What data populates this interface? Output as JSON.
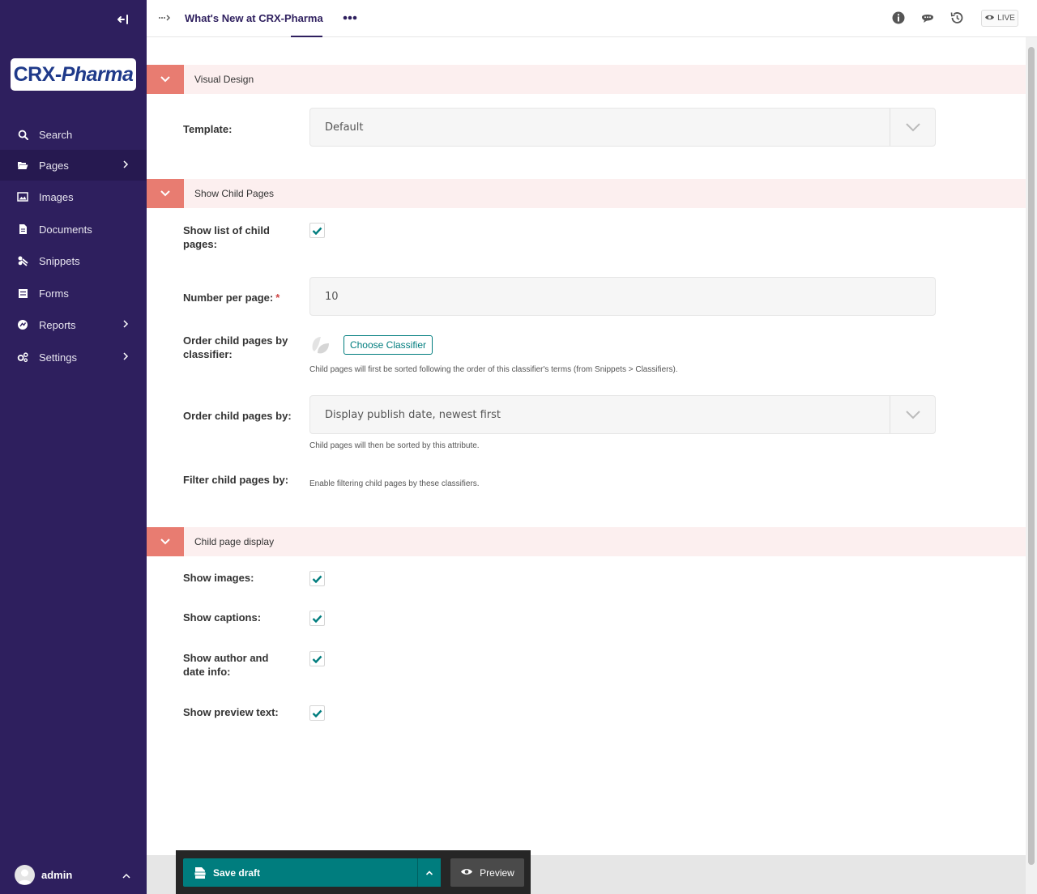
{
  "sidebar": {
    "brand": {
      "part1": "CRX-",
      "part2": "Pharma"
    },
    "items": [
      {
        "label": "Search",
        "icon": "search-icon"
      },
      {
        "label": "Pages",
        "icon": "folder-open-icon",
        "active": true,
        "has_submenu": true
      },
      {
        "label": "Images",
        "icon": "image-icon"
      },
      {
        "label": "Documents",
        "icon": "document-icon"
      },
      {
        "label": "Snippets",
        "icon": "snippet-icon"
      },
      {
        "label": "Forms",
        "icon": "form-icon"
      },
      {
        "label": "Reports",
        "icon": "reports-icon",
        "has_submenu": true
      },
      {
        "label": "Settings",
        "icon": "cogs-icon",
        "has_submenu": true
      }
    ],
    "user": {
      "name": "admin"
    }
  },
  "header": {
    "page_title": "What's New at CRX-Pharma",
    "live_label": "LIVE"
  },
  "sections": {
    "visual_design": {
      "title": "Visual Design",
      "template_label": "Template:",
      "template_value": "Default"
    },
    "child_pages": {
      "title": "Show Child Pages",
      "show_list_label": "Show list of child pages:",
      "show_list_checked": true,
      "per_page_label": "Number per page:",
      "per_page_required": "*",
      "per_page_value": "10",
      "classifier_label": "Order child pages by classifier:",
      "classifier_button": "Choose Classifier",
      "classifier_help": "Child pages will first be sorted following the order of this classifier's terms (from Snippets > Classifiers).",
      "order_by_label": "Order child pages by:",
      "order_by_value": "Display publish date, newest first",
      "order_by_help": "Child pages will then be sorted by this attribute.",
      "filter_label": "Filter child pages by:",
      "filter_help": "Enable filtering child pages by these classifiers."
    },
    "child_display": {
      "title": "Child page display",
      "show_images_label": "Show images:",
      "show_captions_label": "Show captions:",
      "show_author_label": "Show author and date info:",
      "show_preview_label": "Show preview text:"
    }
  },
  "footer": {
    "save_label": "Save draft",
    "preview_label": "Preview"
  },
  "colors": {
    "sidebar_bg": "#2e1f5e",
    "accent_teal": "#007d7e",
    "section_toggle": "#e87c71",
    "section_bg": "#fcefef"
  }
}
